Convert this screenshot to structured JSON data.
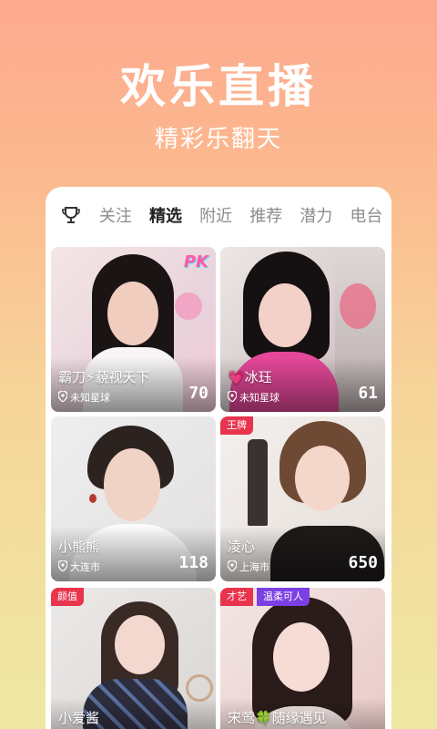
{
  "hero": {
    "title": "欢乐直播",
    "subtitle": "精彩乐翻天"
  },
  "tabs": [
    {
      "label": "关注",
      "active": false
    },
    {
      "label": "精选",
      "active": true
    },
    {
      "label": "附近",
      "active": false
    },
    {
      "label": "推荐",
      "active": false
    },
    {
      "label": "潜力",
      "active": false
    },
    {
      "label": "电台",
      "active": false
    }
  ],
  "cards": [
    {
      "name": "霸刀⚡藐视天下",
      "location": "未知星球",
      "count": "70",
      "tags": [],
      "badge": "PK"
    },
    {
      "name": "💗冰珏",
      "location": "未知星球",
      "count": "61",
      "tags": []
    },
    {
      "name": "小熊熊",
      "location": "大连市",
      "count": "118",
      "tags": []
    },
    {
      "name": "凌心",
      "location": "上海市",
      "count": "650",
      "tags": [
        "王牌"
      ]
    },
    {
      "name": "小爱酱",
      "location": "",
      "count": "",
      "tags": [
        "颜值"
      ]
    },
    {
      "name": "宋莺🍀随缘遇见",
      "location": "",
      "count": "",
      "tags": [
        "才艺",
        "温柔可人"
      ]
    }
  ],
  "colors": {
    "tag_red": "#e8344d",
    "tag_purple": "#7b3fe4",
    "accent": "#ff5aa5"
  }
}
